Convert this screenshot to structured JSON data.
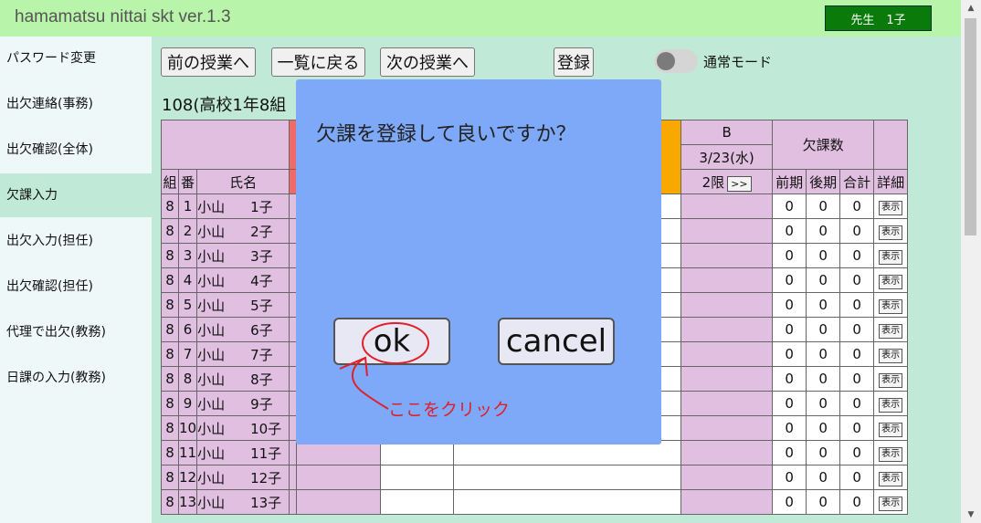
{
  "app": {
    "title": "hamamatsu nittai skt ver.1.3",
    "user": "先生　1子"
  },
  "sidebar": {
    "items": [
      {
        "label": "パスワード変更",
        "active": false
      },
      {
        "label": "出欠連絡(事務)",
        "active": false
      },
      {
        "label": "出欠確認(全体)",
        "active": false
      },
      {
        "label": "欠課入力",
        "active": true
      },
      {
        "label": "出欠入力(担任)",
        "active": false
      },
      {
        "label": "出欠確認(担任)",
        "active": false
      },
      {
        "label": "代理で出欠(教務)",
        "active": false
      },
      {
        "label": "日課の入力(教務)",
        "active": false
      }
    ]
  },
  "toolbar": {
    "prev": "前の授業へ",
    "back": "一覧に戻る",
    "next": "次の授業へ",
    "register": "登録",
    "mode": "通常モード"
  },
  "class_title": "108(高校1年8組",
  "table": {
    "headers": {
      "kumi": "組",
      "ban": "番",
      "name": "氏名",
      "b": "B",
      "date": "3/23(水)",
      "period": "2限",
      "next": ">>",
      "absences": "欠課数",
      "first": "前期",
      "second": "後期",
      "total": "合計",
      "detail": "詳細"
    },
    "rows": [
      {
        "kumi": "8",
        "ban": "1",
        "family": "小山",
        "given": "1子",
        "first": "0",
        "second": "0",
        "total": "0",
        "detail": "表示"
      },
      {
        "kumi": "8",
        "ban": "2",
        "family": "小山",
        "given": "2子",
        "first": "0",
        "second": "0",
        "total": "0",
        "detail": "表示"
      },
      {
        "kumi": "8",
        "ban": "3",
        "family": "小山",
        "given": "3子",
        "first": "0",
        "second": "0",
        "total": "0",
        "detail": "表示"
      },
      {
        "kumi": "8",
        "ban": "4",
        "family": "小山",
        "given": "4子",
        "first": "0",
        "second": "0",
        "total": "0",
        "detail": "表示"
      },
      {
        "kumi": "8",
        "ban": "5",
        "family": "小山",
        "given": "5子",
        "first": "0",
        "second": "0",
        "total": "0",
        "detail": "表示"
      },
      {
        "kumi": "8",
        "ban": "6",
        "family": "小山",
        "given": "6子",
        "first": "0",
        "second": "0",
        "total": "0",
        "detail": "表示"
      },
      {
        "kumi": "8",
        "ban": "7",
        "family": "小山",
        "given": "7子",
        "first": "0",
        "second": "0",
        "total": "0",
        "detail": "表示"
      },
      {
        "kumi": "8",
        "ban": "8",
        "family": "小山",
        "given": "8子",
        "first": "0",
        "second": "0",
        "total": "0",
        "detail": "表示"
      },
      {
        "kumi": "8",
        "ban": "9",
        "family": "小山",
        "given": "9子",
        "first": "0",
        "second": "0",
        "total": "0",
        "detail": "表示"
      },
      {
        "kumi": "8",
        "ban": "10",
        "family": "小山",
        "given": "10子",
        "first": "0",
        "second": "0",
        "total": "0",
        "detail": "表示"
      },
      {
        "kumi": "8",
        "ban": "11",
        "family": "小山",
        "given": "11子",
        "first": "0",
        "second": "0",
        "total": "0",
        "detail": "表示"
      },
      {
        "kumi": "8",
        "ban": "12",
        "family": "小山",
        "given": "12子",
        "first": "0",
        "second": "0",
        "total": "0",
        "detail": "表示"
      },
      {
        "kumi": "8",
        "ban": "13",
        "family": "小山",
        "given": "13子",
        "first": "0",
        "second": "0",
        "total": "0",
        "detail": "表示"
      }
    ]
  },
  "modal": {
    "message": "欠課を登録して良いですか？",
    "ok": "ok",
    "cancel": "cancel"
  },
  "annotation": {
    "text": "ここをクリック",
    "color": "#e0202a"
  },
  "colors": {
    "titlebar": "#b8f4a9",
    "modal": "#7ea8f8",
    "badge": "#0a7b0a",
    "cell_pink": "#e0bfe0"
  }
}
